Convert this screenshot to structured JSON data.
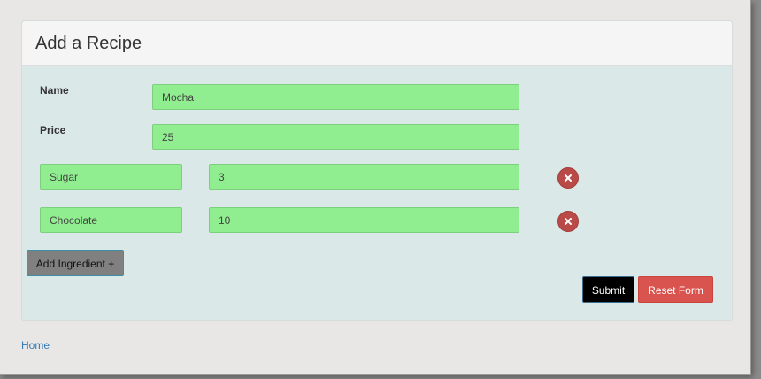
{
  "form": {
    "title": "Add a Recipe",
    "name_label": "Name",
    "name_value": "Mocha",
    "price_label": "Price",
    "price_value": "25",
    "ingredients": [
      {
        "name": "Sugar",
        "amount": "3"
      },
      {
        "name": "Chocolate",
        "amount": "10"
      }
    ],
    "add_ingredient_label": "Add Ingredient +",
    "submit_label": "Submit",
    "reset_label": "Reset Form"
  },
  "footer": {
    "home_link": "Home"
  },
  "icons": {
    "remove": "close-icon"
  },
  "colors": {
    "field_background": "#90ee90",
    "remove_button": "#b94a48",
    "reset_button": "#d9534f",
    "submit_button": "#000000",
    "add_button": "#808080",
    "link": "#337ab7"
  }
}
